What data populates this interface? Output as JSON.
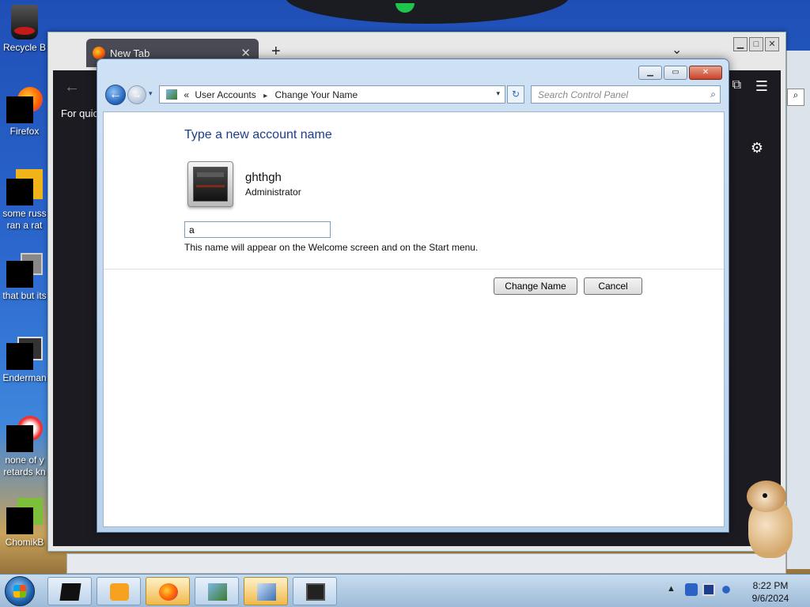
{
  "desktop": {
    "icons": [
      {
        "label": "Recycle B"
      },
      {
        "label": "Firefox"
      },
      {
        "label": "some russ ran a rat"
      },
      {
        "label": "that but its"
      },
      {
        "label": "Enderman"
      },
      {
        "label": "none of y retards kn"
      },
      {
        "label": "ChomikB"
      }
    ]
  },
  "browser": {
    "tab_label": "New Tab",
    "tab_close": "✕",
    "new_tab": "+",
    "tab_list": "⌄",
    "back": "←",
    "quick_text": "For quic",
    "menu": "☰",
    "gear": "⚙",
    "window_controls": {
      "minimize": "▁",
      "maximize": "□",
      "close": "✕"
    }
  },
  "control_panel": {
    "window_controls": {
      "minimize": "▁",
      "maximize": "▭",
      "close": "✕"
    },
    "nav": {
      "back": "←",
      "forward": "→",
      "history": "▾"
    },
    "breadcrumb": {
      "overflow": "«",
      "items": [
        "User Accounts",
        "Change Your Name"
      ],
      "separator": "▸",
      "dropdown": "▾"
    },
    "refresh": "↻",
    "search_placeholder": "Search Control Panel",
    "search_icon": "⌕",
    "heading": "Type a new account name",
    "user": {
      "name": "ghthgh",
      "role": "Administrator"
    },
    "name_value": "a",
    "hint": "This name will appear on the Welcome screen and on the Start menu.",
    "buttons": {
      "change": "Change Name",
      "cancel": "Cancel"
    }
  },
  "taskbar": {
    "tray_expand": "▲",
    "clock_time": "8:22 PM",
    "clock_date": "9/6/2024"
  },
  "colors": {
    "accent_heading": "#1e3d8a",
    "start_orb": "#1d5ea8"
  }
}
